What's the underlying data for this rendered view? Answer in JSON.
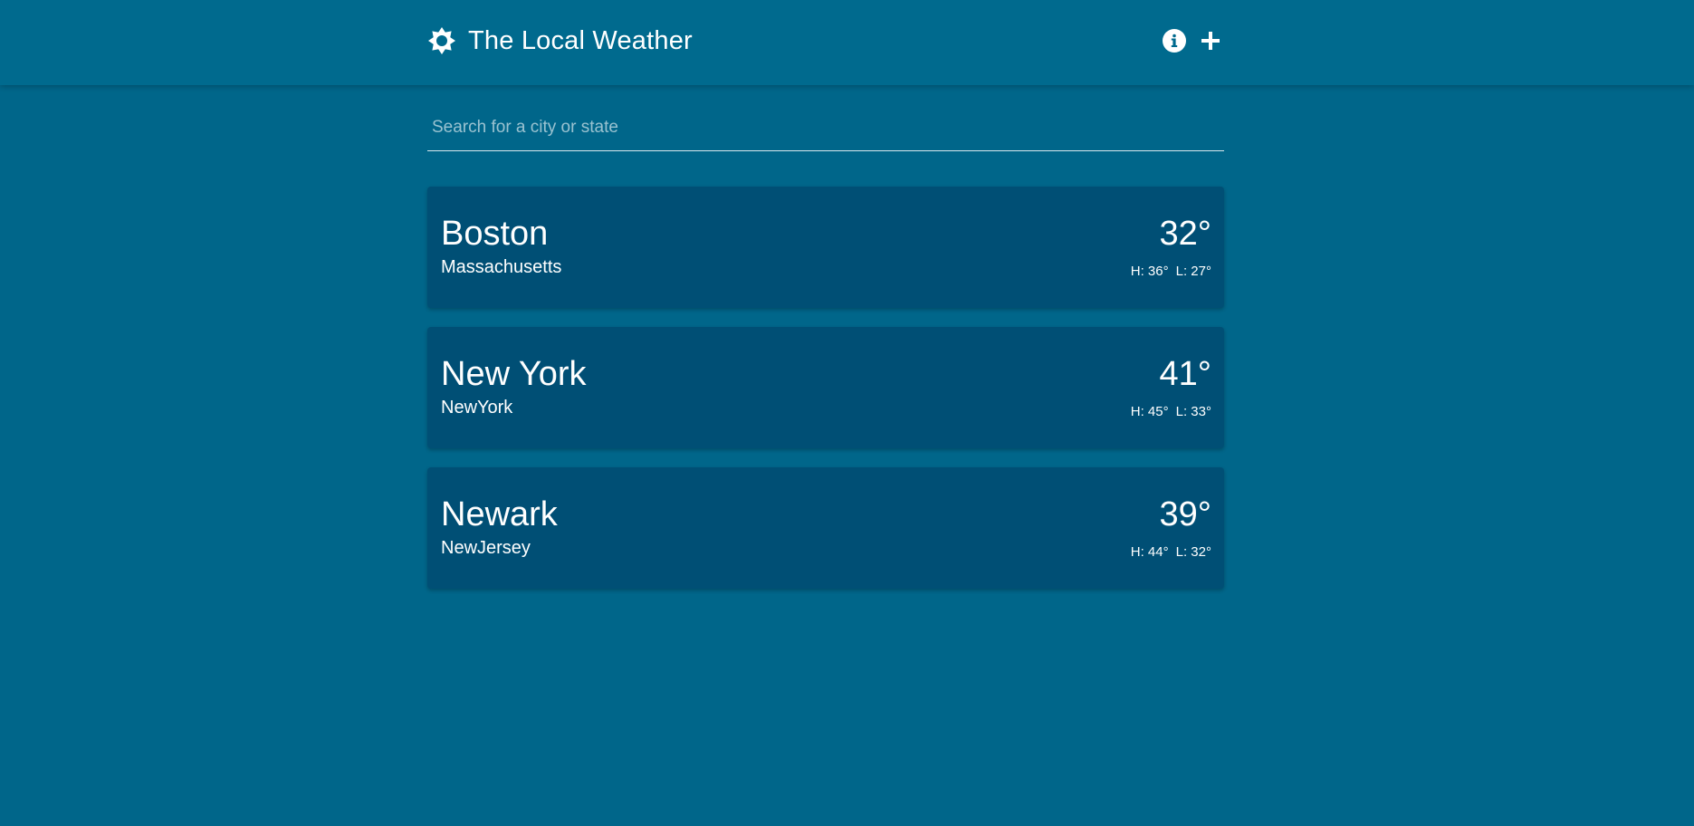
{
  "app": {
    "title": "The Local Weather",
    "logo_icon": "sun-icon",
    "info_icon": "info-circle-icon",
    "add_icon": "plus-icon"
  },
  "search": {
    "placeholder": "Search for a city or state",
    "value": ""
  },
  "cities": [
    {
      "city": "Boston",
      "state": "Massachusetts",
      "temp": "32°",
      "high": "H: 36°",
      "low": "L: 27°"
    },
    {
      "city": "New York",
      "state": "NewYork",
      "temp": "41°",
      "high": "H: 45°",
      "low": "L: 33°"
    },
    {
      "city": "Newark",
      "state": "NewJersey",
      "temp": "39°",
      "high": "H: 44°",
      "low": "L: 32°"
    }
  ],
  "colors": {
    "background": "#00668a",
    "app_bar": "#006a8e",
    "card": "#004f75",
    "text": "#ffffff"
  }
}
